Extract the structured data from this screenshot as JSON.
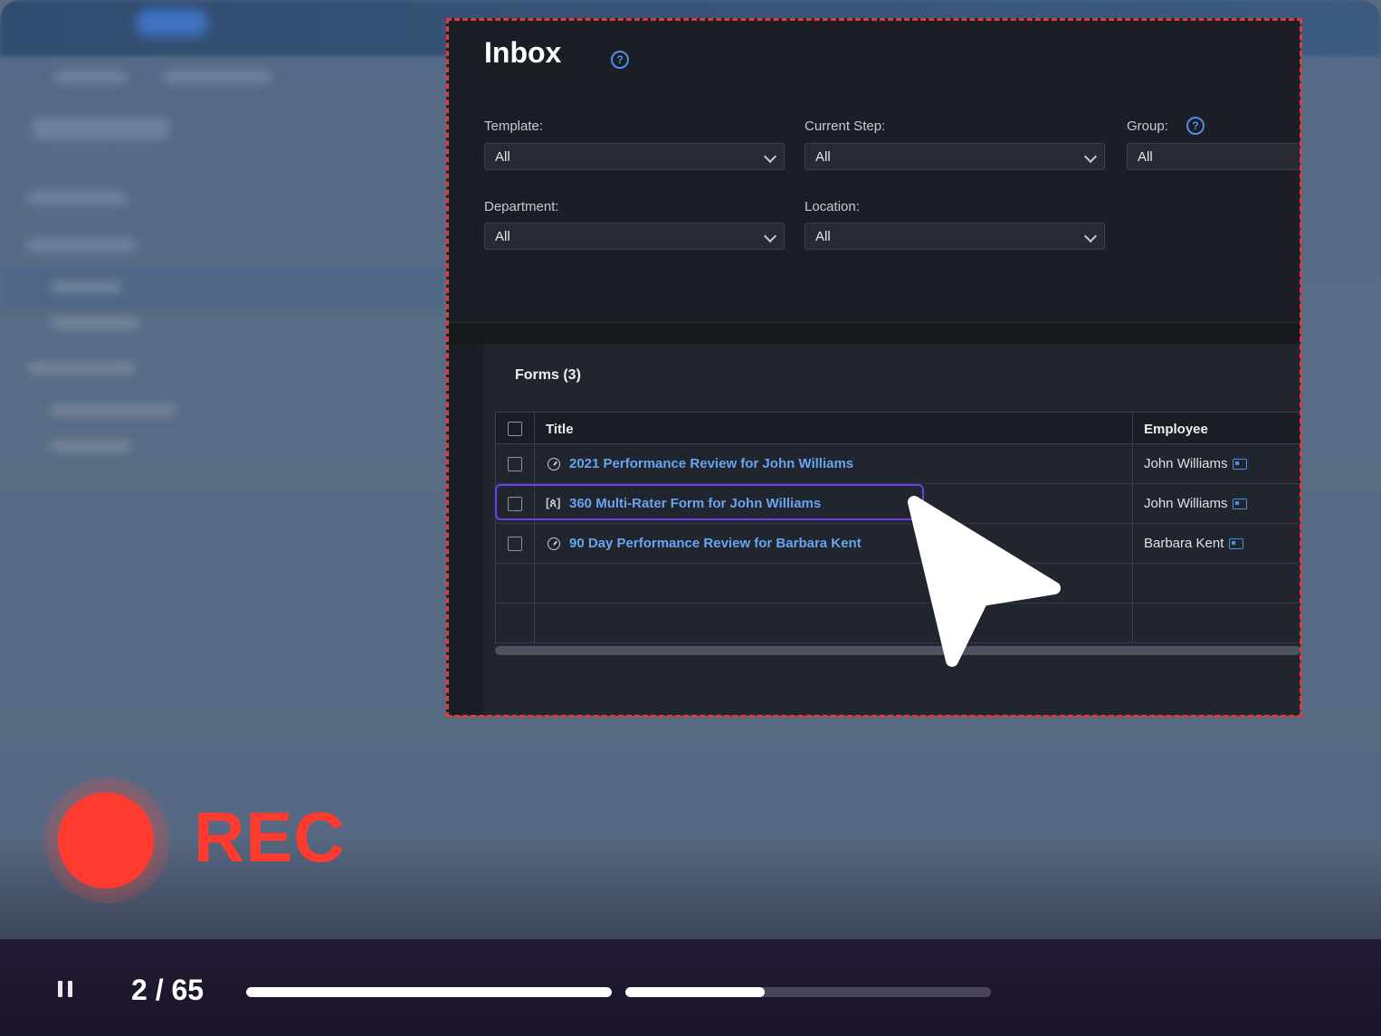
{
  "inbox": {
    "title": "Inbox",
    "help_icon": "question-circle-icon",
    "filters": {
      "template": {
        "label": "Template:",
        "value": "All"
      },
      "current_step": {
        "label": "Current Step:",
        "value": "All"
      },
      "group": {
        "label": "Group:",
        "value": "All"
      },
      "department": {
        "label": "Department:",
        "value": "All"
      },
      "location": {
        "label": "Location:",
        "value": "All"
      }
    },
    "forms": {
      "heading": "Forms (3)",
      "columns": {
        "title": "Title",
        "employee": "Employee"
      },
      "rows": [
        {
          "title": "2021 Performance Review for John Williams",
          "employee": "John Williams",
          "icon": "clock-icon"
        },
        {
          "title": "360 Multi-Rater Form for John Williams",
          "employee": "John Williams",
          "icon": "multi-rater-icon"
        },
        {
          "title": "90 Day Performance Review for Barbara Kent",
          "employee": "Barbara Kent",
          "icon": "clock-icon"
        }
      ]
    }
  },
  "recording": {
    "label": "REC",
    "color": "#ff3b2f"
  },
  "player": {
    "counter": "2 / 65",
    "progress": [
      1.0,
      0.38,
      0.0
    ],
    "accent": "#ffffff"
  },
  "highlight_color": "#6d3ef0",
  "dashed_border_color": "#e03a3a"
}
